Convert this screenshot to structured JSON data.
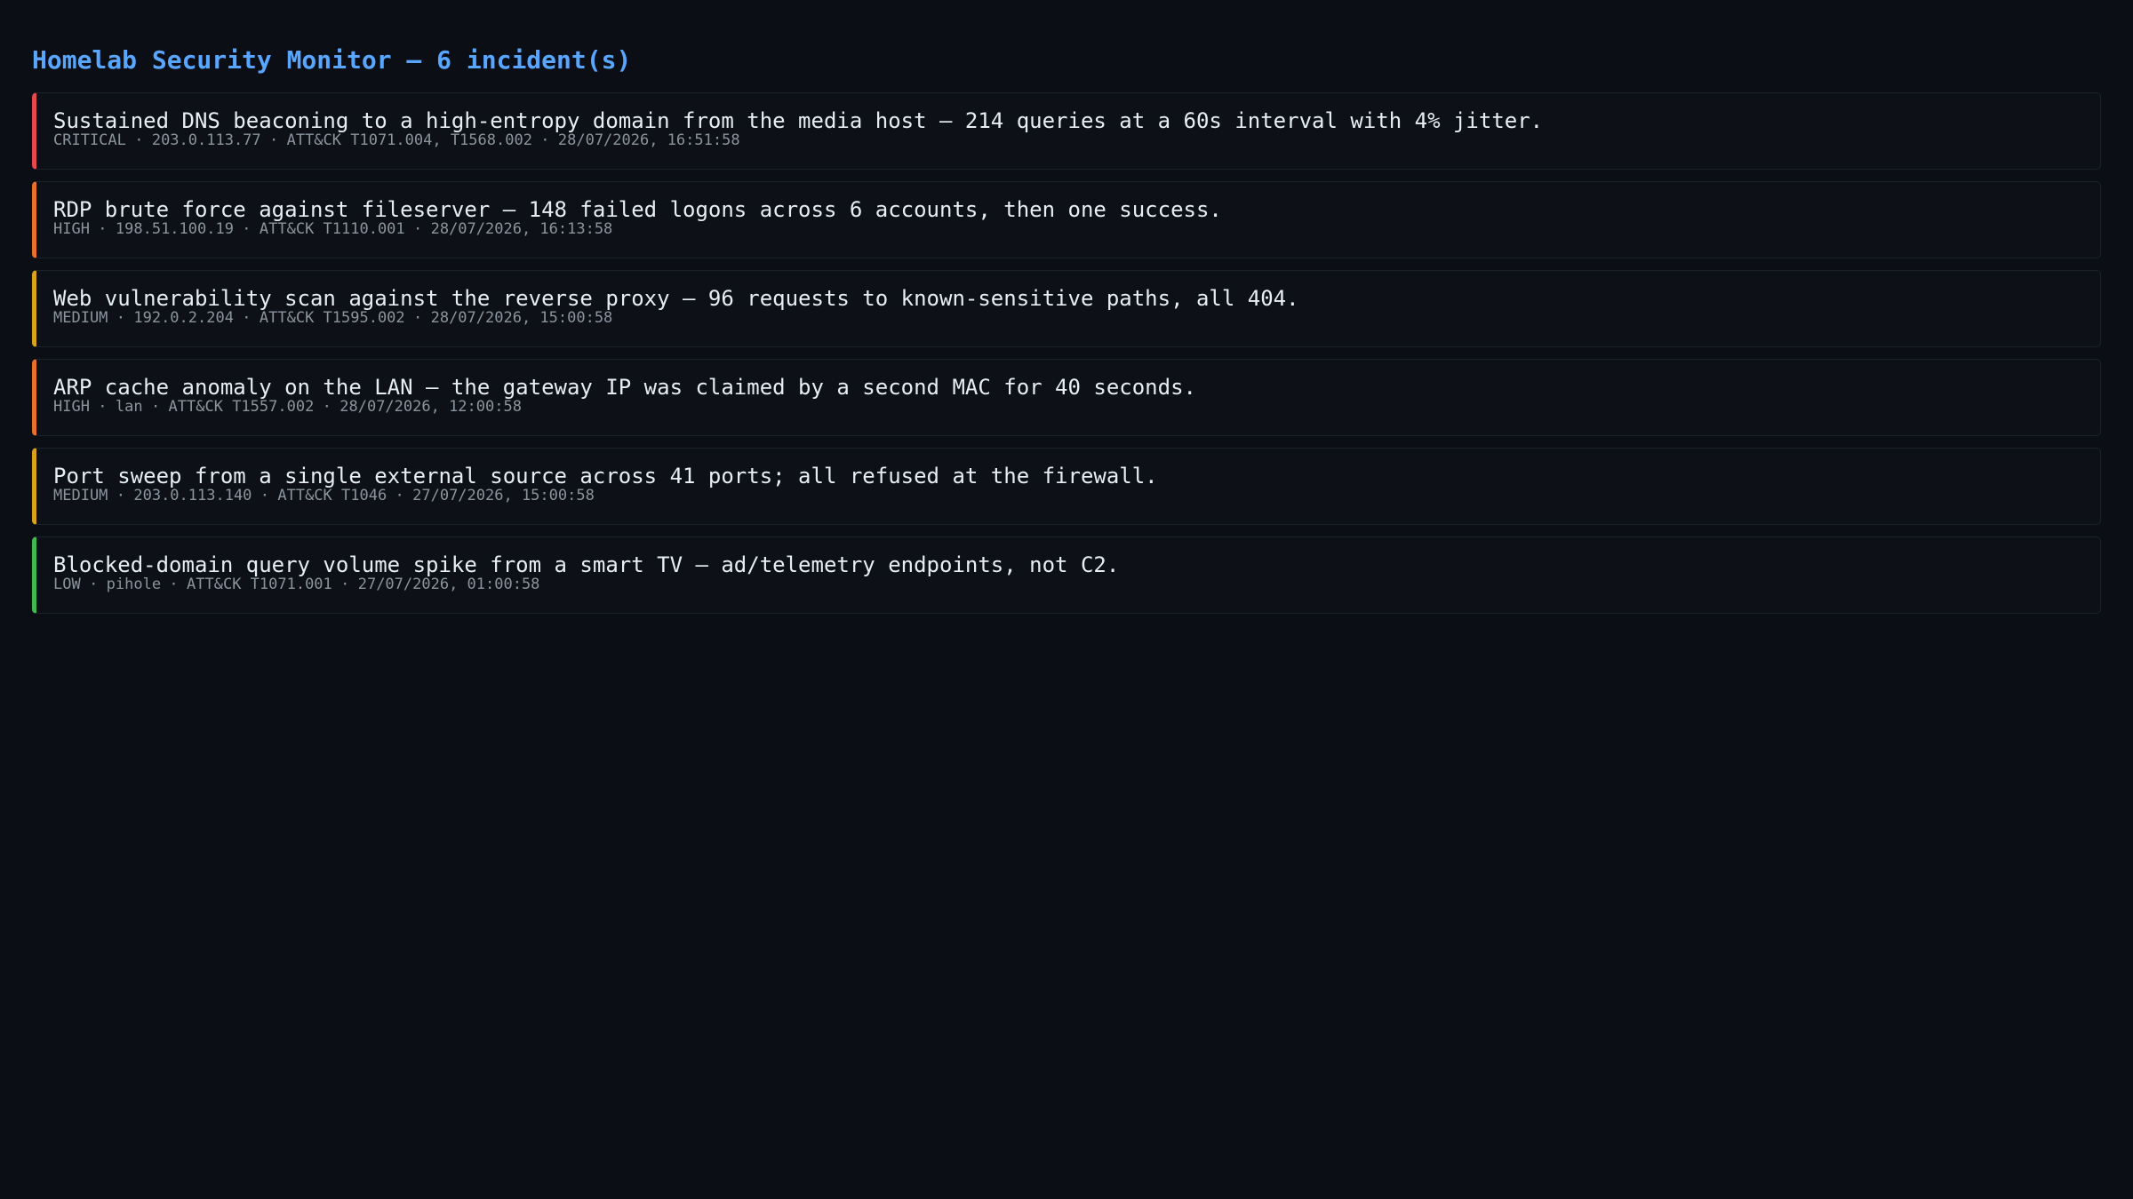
{
  "page": {
    "title": "Homelab Security Monitor — 6 incident(s)"
  },
  "severity_colors": {
    "CRITICAL": "#e5484d",
    "HIGH": "#e8702a",
    "MEDIUM": "#d9a21b",
    "LOW": "#3fb950"
  },
  "incidents": [
    {
      "summary": "Sustained DNS beaconing to a high-entropy domain from the media host — 214 queries at a 60s interval with 4% jitter.",
      "severity": "CRITICAL",
      "source": "203.0.113.77",
      "attack": "ATT&CK T1071.004, T1568.002",
      "timestamp": "28/07/2026, 16:51:58"
    },
    {
      "summary": "RDP brute force against fileserver — 148 failed logons across 6 accounts, then one success.",
      "severity": "HIGH",
      "source": "198.51.100.19",
      "attack": "ATT&CK T1110.001",
      "timestamp": "28/07/2026, 16:13:58"
    },
    {
      "summary": "Web vulnerability scan against the reverse proxy — 96 requests to known-sensitive paths, all 404.",
      "severity": "MEDIUM",
      "source": "192.0.2.204",
      "attack": "ATT&CK T1595.002",
      "timestamp": "28/07/2026, 15:00:58"
    },
    {
      "summary": "ARP cache anomaly on the LAN — the gateway IP was claimed by a second MAC for 40 seconds.",
      "severity": "HIGH",
      "source": "lan",
      "attack": "ATT&CK T1557.002",
      "timestamp": "28/07/2026, 12:00:58"
    },
    {
      "summary": "Port sweep from a single external source across 41 ports; all refused at the firewall.",
      "severity": "MEDIUM",
      "source": "203.0.113.140",
      "attack": "ATT&CK T1046",
      "timestamp": "27/07/2026, 15:00:58"
    },
    {
      "summary": "Blocked-domain query volume spike from a smart TV — ad/telemetry endpoints, not C2.",
      "severity": "LOW",
      "source": "pihole",
      "attack": "ATT&CK T1071.001",
      "timestamp": "27/07/2026, 01:00:58"
    }
  ]
}
